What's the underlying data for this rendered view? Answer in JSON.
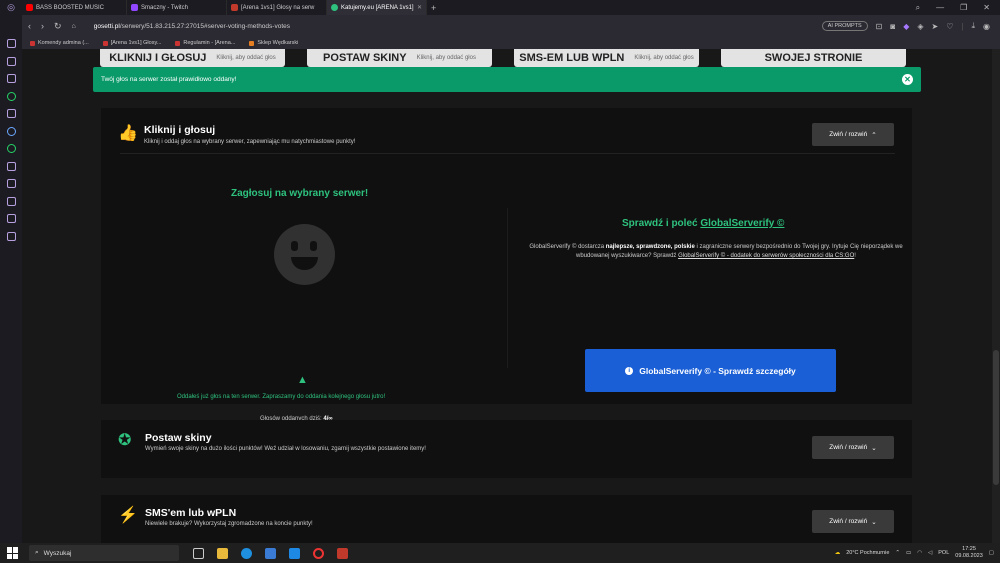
{
  "browser": {
    "tabs": [
      {
        "title": "BASS BOOSTED MUSIC",
        "color": "#ff0000"
      },
      {
        "title": "Smaczny - Twitch",
        "color": "#9146ff"
      },
      {
        "title": "[Arena 1vs1] Głosy na serw",
        "color": "#c0392b"
      },
      {
        "title": "Katujemy.eu [ARENA 1vs1]",
        "color": "#2ec27e"
      }
    ],
    "url_host": "gosetti.pl",
    "url_path": "/serwery/51.83.215.27:27015#server-voting-methods-votes",
    "ai_prompts": "AI PROMPTS",
    "bookmarks": [
      "Komendy admina (...",
      "[Arena 1vs1] Głosy...",
      "Regulamin - [Arena...",
      "Sklep Wędkarski"
    ]
  },
  "top_cards": [
    {
      "label": "KLIKNIJ I GŁOSUJ",
      "sub": "Kliknij, aby oddać głos"
    },
    {
      "label": "POSTAW SKINY",
      "sub": "Kliknij, aby oddać głos"
    },
    {
      "label": "SMS-EM LUB WPLN",
      "sub": "Kliknij, aby oddać głos"
    },
    {
      "label": "SWOJEJ STRONIE",
      "sub": ""
    }
  ],
  "alert": {
    "message": "Twój głos na serwer został prawidłowo oddany!"
  },
  "click_vote": {
    "title": "Kliknij i głosuj",
    "subtitle": "Kliknij i oddaj głos na wybrany serwer, zapewniając mu natychmiastowe punkty!",
    "toggle": "Zwiń / rozwiń",
    "vote_title": "Zagłosuj na wybrany serwer!",
    "vote_message": "Oddałeś już głos na ten serwer. Zapraszamy do oddania kolejnego głosu jutro!",
    "votes_label": "Głosów oddanych dziś:",
    "votes_value": "4/∞",
    "gs_title_prefix": "Sprawdź i poleć",
    "gs_title_link": "GlobalServerify ©",
    "gs_desc_1": "GlobalServerify © dostarcza ",
    "gs_desc_bold": "najlepsze, sprawdzone, polskie",
    "gs_desc_2": " i zagraniczne serwery bezpośrednio do Twojej gry. Irytuje Cię nieporządek we wbudowanej wyszukiwarce? Sprawdź ",
    "gs_desc_link": "GlobalServerify © - dodatek do serwerów społeczności dla CS:GO",
    "gs_desc_3": "!",
    "gs_button": "GlobalServerify © - Sprawdź szczegóły"
  },
  "skins": {
    "title": "Postaw skiny",
    "subtitle": "Wymień swoje skiny na dużo ilości punktów! Weź udział w losowaniu, zgarnij wszystkie postawione itemy!",
    "toggle": "Zwiń / rozwiń"
  },
  "sms": {
    "title": "SMS'em lub wPLN",
    "subtitle": "Niewiele brakuje? Wykorzystaj zgromadzone na koncie punkty!",
    "toggle": "Zwiń / rozwiń"
  },
  "taskbar": {
    "search": "Wyszukaj",
    "weather": "20°C  Pochmurnie",
    "lang": "POL",
    "time": "17:25",
    "date": "09.08.2023"
  }
}
